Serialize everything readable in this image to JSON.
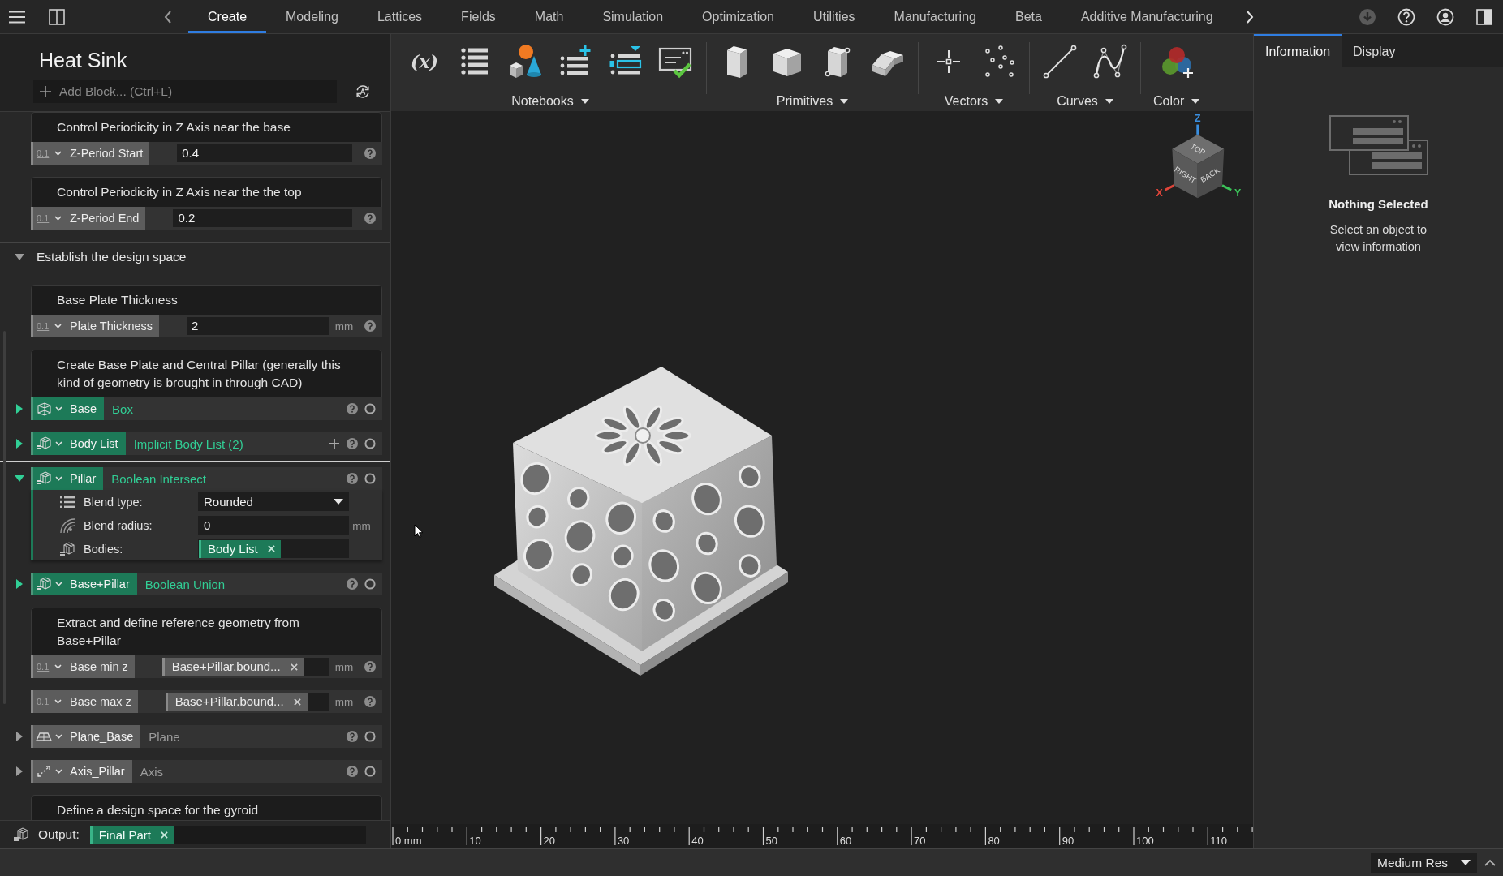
{
  "top_bar": {
    "tabs": [
      {
        "label": "Create",
        "selected": true
      },
      {
        "label": "Modeling",
        "selected": false
      },
      {
        "label": "Lattices",
        "selected": false
      },
      {
        "label": "Fields",
        "selected": false
      },
      {
        "label": "Math",
        "selected": false
      },
      {
        "label": "Simulation",
        "selected": false
      },
      {
        "label": "Optimization",
        "selected": false
      },
      {
        "label": "Utilities",
        "selected": false
      },
      {
        "label": "Manufacturing",
        "selected": false
      },
      {
        "label": "Beta",
        "selected": false
      },
      {
        "label": "Additive Manufacturing",
        "selected": false
      }
    ]
  },
  "notebook": {
    "title": "Heat Sink",
    "add_block": {
      "placeholder": "Add Block... (Ctrl+L)"
    },
    "items": [
      {
        "kind": "note",
        "text": "Control Periodicity in Z Axis near the base"
      },
      {
        "kind": "param",
        "type_glyph": "0.1",
        "name": "Z-Period Start",
        "value": "0.4"
      },
      {
        "kind": "note",
        "text": "Control Periodicity in Z Axis near the the top"
      },
      {
        "kind": "param",
        "type_glyph": "0.1",
        "name": "Z-Period End",
        "value": "0.2"
      },
      {
        "kind": "section",
        "title": "Establish the design space",
        "expanded": true,
        "children": [
          {
            "kind": "note",
            "text": "Base Plate Thickness"
          },
          {
            "kind": "param",
            "type_glyph": "0.1",
            "name": "Plate Thickness",
            "value": "2",
            "unit": "mm"
          },
          {
            "kind": "note",
            "text": "Create Base Plate and Central Pillar (generally this kind of geometry is brought in through CAD)"
          },
          {
            "kind": "box",
            "name": "Base",
            "type": "Box",
            "color": "#1d7a58",
            "expanded": false,
            "addable": false
          },
          {
            "kind": "body",
            "name": "Body List",
            "type": "Implicit Body List (2)",
            "color": "#1d7a58",
            "expanded": false,
            "addable": true
          },
          {
            "kind": "body",
            "name": "Pillar",
            "type": "Boolean Intersect",
            "color": "#1d7a58",
            "expanded": true,
            "addable": false,
            "inputs": [
              {
                "kind": "dropdown",
                "label": "Blend type:",
                "value": "Rounded"
              },
              {
                "kind": "number",
                "label": "Blend radius:",
                "value": "0",
                "unit": "mm"
              },
              {
                "kind": "bodies",
                "label": "Bodies:",
                "chips": [
                  "Body List"
                ]
              }
            ]
          },
          {
            "kind": "body",
            "name": "Base+Pillar",
            "type": "Boolean Union",
            "color": "#1d7a58",
            "expanded": false,
            "addable": false
          },
          {
            "kind": "note",
            "text": "Extract and define reference geometry from Base+Pillar"
          },
          {
            "kind": "param",
            "type_glyph": "0.1",
            "name": "Base min z",
            "reference": "Base+Pillar.bound...",
            "unit": "mm"
          },
          {
            "kind": "param",
            "type_glyph": "0.1",
            "name": "Base max z",
            "reference": "Base+Pillar.bound...",
            "unit": "mm"
          },
          {
            "kind": "plane",
            "name": "Plane_Base",
            "type": "Plane",
            "color": "#5c5c5c",
            "expanded": false,
            "addable": false
          },
          {
            "kind": "axis",
            "name": "Axis_Pillar",
            "type": "Axis",
            "color": "#5c5c5c",
            "expanded": false,
            "addable": false
          },
          {
            "kind": "note",
            "text": "Define a design space for the gyroid"
          }
        ]
      }
    ],
    "output": {
      "label": "Output:",
      "chips": [
        "Final Part"
      ]
    }
  },
  "toolbar": {
    "groups": [
      {
        "kind": "notebooks",
        "label": "Notebooks",
        "glyph": "(x)"
      },
      {
        "kind": "primitives",
        "label": "Primitives"
      },
      {
        "kind": "vectors",
        "label": "Vectors"
      },
      {
        "kind": "curves",
        "label": "Curves"
      },
      {
        "kind": "color",
        "label": "Color"
      }
    ]
  },
  "viewport": {
    "view_cube": {
      "faces": [
        "TOP",
        "RIGHT",
        "BACK"
      ],
      "axes": [
        {
          "label": "X",
          "color": "#e0453a"
        },
        {
          "label": "Y",
          "color": "#3cc45a"
        },
        {
          "label": "Z",
          "color": "#3a8fe0"
        }
      ]
    },
    "ruler": {
      "labels": [
        "0 mm",
        "10",
        "20",
        "30",
        "40",
        "50",
        "60",
        "70",
        "80",
        "90",
        "100",
        "110"
      ]
    }
  },
  "inspector": {
    "tabs": [
      {
        "label": "Information",
        "selected": true
      },
      {
        "label": "Display",
        "selected": false
      }
    ],
    "empty_state": {
      "title": "Nothing Selected",
      "text": "Select an object to view information"
    }
  },
  "status_bar": {
    "resolution": "Medium Res"
  }
}
